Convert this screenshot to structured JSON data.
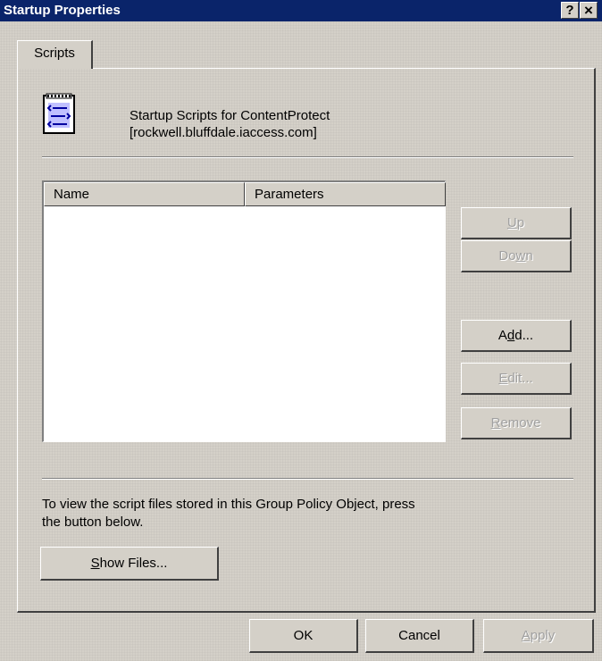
{
  "window": {
    "title": "Startup Properties",
    "help_button": "?",
    "close_button": "×"
  },
  "tabs": [
    {
      "label": "Scripts"
    }
  ],
  "header": {
    "icon": "script-icon",
    "line1": "Startup Scripts for ContentProtect",
    "line2": "[rockwell.bluffdale.iaccess.com]"
  },
  "list": {
    "columns": [
      "Name",
      "Parameters"
    ],
    "rows": []
  },
  "side_buttons": {
    "up": {
      "prefix": "",
      "accel": "U",
      "rest": "p",
      "disabled": true
    },
    "down": {
      "prefix": "Do",
      "accel": "w",
      "rest": "n",
      "disabled": true
    },
    "add": {
      "prefix": "A",
      "accel": "d",
      "rest": "d...",
      "disabled": false
    },
    "edit": {
      "prefix": "",
      "accel": "E",
      "rest": "dit...",
      "disabled": true
    },
    "remove": {
      "prefix": "",
      "accel": "R",
      "rest": "emove",
      "disabled": true
    }
  },
  "info": {
    "line1": "To view the script files stored in this Group Policy Object, press",
    "line2": "the button below."
  },
  "show_files": {
    "prefix": "",
    "accel": "S",
    "rest": "how Files..."
  },
  "footer": {
    "ok": "OK",
    "cancel": "Cancel",
    "apply": {
      "prefix": "",
      "accel": "A",
      "rest": "pply",
      "disabled": true
    }
  }
}
